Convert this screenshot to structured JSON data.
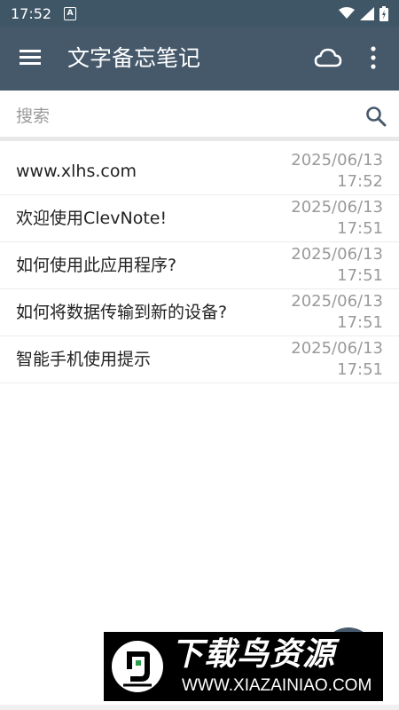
{
  "status_bar": {
    "time": "17:52",
    "notif_letter": "A"
  },
  "app_bar": {
    "title": "文字备忘笔记"
  },
  "search": {
    "placeholder": "搜索",
    "value": ""
  },
  "notes": [
    {
      "title": "www.xlhs.com",
      "date": "2025/06/13",
      "time": "17:52"
    },
    {
      "title": "欢迎使用ClevNote!",
      "date": "2025/06/13",
      "time": "17:51"
    },
    {
      "title": "如何使用此应用程序?",
      "date": "2025/06/13",
      "time": "17:51"
    },
    {
      "title": "如何将数据传输到新的设备?",
      "date": "2025/06/13",
      "time": "17:51"
    },
    {
      "title": "智能手机使用提示",
      "date": "2025/06/13",
      "time": "17:51"
    }
  ],
  "watermark": {
    "brand": "下载鸟资源",
    "url": "WWW.XIAZAINIAO.COM"
  },
  "colors": {
    "primary": "#46596b",
    "status_bar": "#3f5667",
    "date_text": "#9a9a9a"
  },
  "icons": {
    "menu": "menu-icon",
    "cloud": "cloud-icon",
    "more": "more-vert-icon",
    "search": "search-icon"
  }
}
